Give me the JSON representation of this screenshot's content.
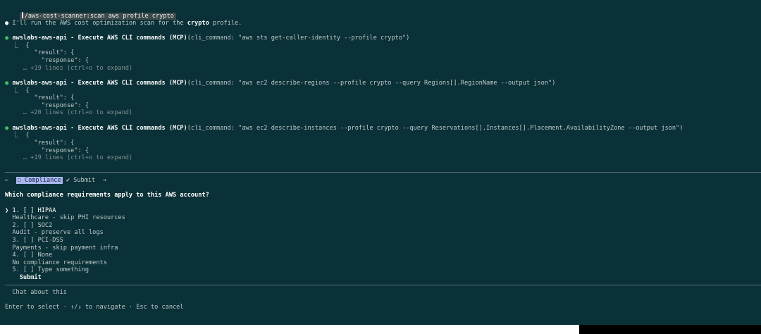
{
  "command": "/aws-cost-scanner:scan aws profile crypto",
  "intro": {
    "prefix": "I'll run the AWS cost optimization scan for the ",
    "profile": "crypto",
    "suffix": " profile."
  },
  "tool_calls": [
    {
      "name": "awslabs-aws-api - Execute AWS CLI commands (MCP)",
      "args": "(cli_command: \"aws sts get-caller-identity --profile crypto\")",
      "out1": "{",
      "out2": "\"result\": {",
      "out3": "\"response\": {",
      "more": "… +19 lines (ctrl+o to expand)"
    },
    {
      "name": "awslabs-aws-api - Execute AWS CLI commands (MCP)",
      "args": "(cli_command: \"aws ec2 describe-regions --profile crypto --query Regions[].RegionName --output json\")",
      "out1": "{",
      "out2": "\"result\": {",
      "out3": "\"response\": {",
      "more": "… +20 lines (ctrl+o to expand)"
    },
    {
      "name": "awslabs-aws-api - Execute AWS CLI commands (MCP)",
      "args": "(cli_command: \"aws ec2 describe-instances --profile crypto --query Reservations[].Instances[].Placement.AvailabilityZone --output json\")",
      "out1": "{",
      "out2": "\"result\": {",
      "out3": "\"response\": {",
      "more": "… +19 lines (ctrl+o to expand)"
    }
  ],
  "tabs": {
    "back": "←",
    "compliance": "☐ Compliance",
    "submit": "✔ Submit",
    "forward": "→"
  },
  "question": "Which compliance requirements apply to this AWS account?",
  "options": [
    {
      "label": "1. [ ] HIPAA",
      "desc": "Healthcare - skip PHI resources"
    },
    {
      "label": "2. [ ] SOC2",
      "desc": "Audit - preserve all logs"
    },
    {
      "label": "3. [ ] PCI-DSS",
      "desc": "Payments - skip payment infra"
    },
    {
      "label": "4. [ ] None",
      "desc": "No compliance requirements"
    },
    {
      "label": "5. [ ] Type something"
    }
  ],
  "submit_label": "Submit",
  "chat_label": "Chat about this",
  "footer_help": "Enter to select · ↑/↓ to navigate · Esc to cancel",
  "glyphs": {
    "bullet": "●",
    "pointer": "❯",
    "elbow": "⎿"
  },
  "colors": {
    "background": "#0a3137",
    "success_bullet": "#3fbf5f",
    "active_tab": "#a9b8f0"
  }
}
